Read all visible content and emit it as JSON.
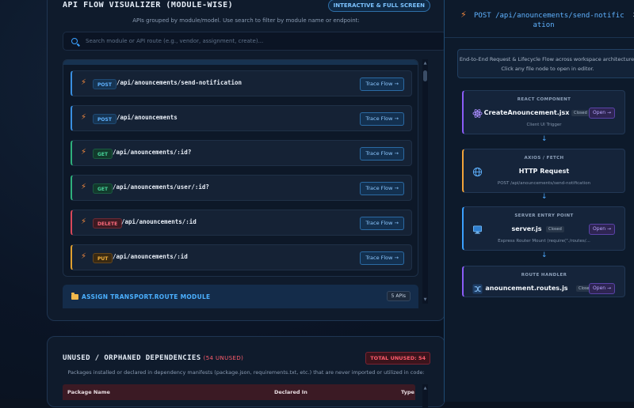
{
  "flow_panel": {
    "title": "API FLOW VISUALIZER (MODULE-WISE)",
    "badge": "INTERACTIVE & FULL SCREEN",
    "subtitle": "APIs grouped by module/model. Use search to filter by module name or endpoint:",
    "search": {
      "placeholder": "Search module or API route (e.g., vendor, assignment, create)...",
      "value": ""
    },
    "endpoints": [
      {
        "method": "POST",
        "route": "/api/anouncements/send-notification",
        "action": "Trace Flow →"
      },
      {
        "method": "POST",
        "route": "/api/anouncements",
        "action": "Trace Flow →"
      },
      {
        "method": "GET",
        "route": "/api/anouncements/:id?",
        "action": "Trace Flow →"
      },
      {
        "method": "GET",
        "route": "/api/anouncements/user/:id?",
        "action": "Trace Flow →"
      },
      {
        "method": "DELETE",
        "route": "/api/anouncements/:id",
        "action": "Trace Flow →"
      },
      {
        "method": "PUT",
        "route": "/api/anouncements/:id",
        "action": "Trace Flow →"
      }
    ],
    "module2": {
      "title": "ASSIGN TRANSPORT.ROUTE MODULE",
      "count": "5 APIs"
    }
  },
  "unused_panel": {
    "title": "UNUSED / ORPHANED DEPENDENCIES",
    "count": "(54 UNUSED)",
    "total_badge": "TOTAL UNUSED: 54",
    "description": "Packages installed or declared in dependency manifests (package.json, requirements.txt, etc.) that are never imported or utilized in code:",
    "columns": [
      "Package Name",
      "Declared In",
      "Type"
    ]
  },
  "trace_panel": {
    "title_line1": "POST /api/anouncements/send-notific",
    "title_line2": "ation",
    "close": "x",
    "description": "End-to-End Request & Lifecycle Flow across workspace architecture. Click any file node to open in editor.",
    "nodes": [
      {
        "type": "REACT COMPONENT",
        "name": "CreateAnouncement.jsx",
        "status": "Closed",
        "action": "Open →",
        "sub": "Client UI Trigger",
        "icon": "react-icon"
      },
      {
        "type": "AXIOS / FETCH",
        "name": "HTTP Request",
        "sub": "POST /api/anouncements/send-notification",
        "icon": "globe-icon"
      },
      {
        "type": "SERVER ENTRY POINT",
        "name": "server.js",
        "status": "Closed",
        "action": "Open →",
        "sub": "Express Router Mount (require(\"./routes/...",
        "icon": "monitor-icon"
      },
      {
        "type": "ROUTE HANDLER",
        "name": "anouncement.routes.js",
        "status": "Closed",
        "action": "Open →",
        "sub": "",
        "icon": "shuffle-icon"
      }
    ],
    "arrow": "↓"
  },
  "colors": {
    "post": "#5fb2ff",
    "get": "#46d39a",
    "delete": "#ff6b7d",
    "put": "#f4b23c",
    "accent": "#4bb0ff",
    "danger": "#ff5b6c",
    "open": "#b9a6ff"
  }
}
